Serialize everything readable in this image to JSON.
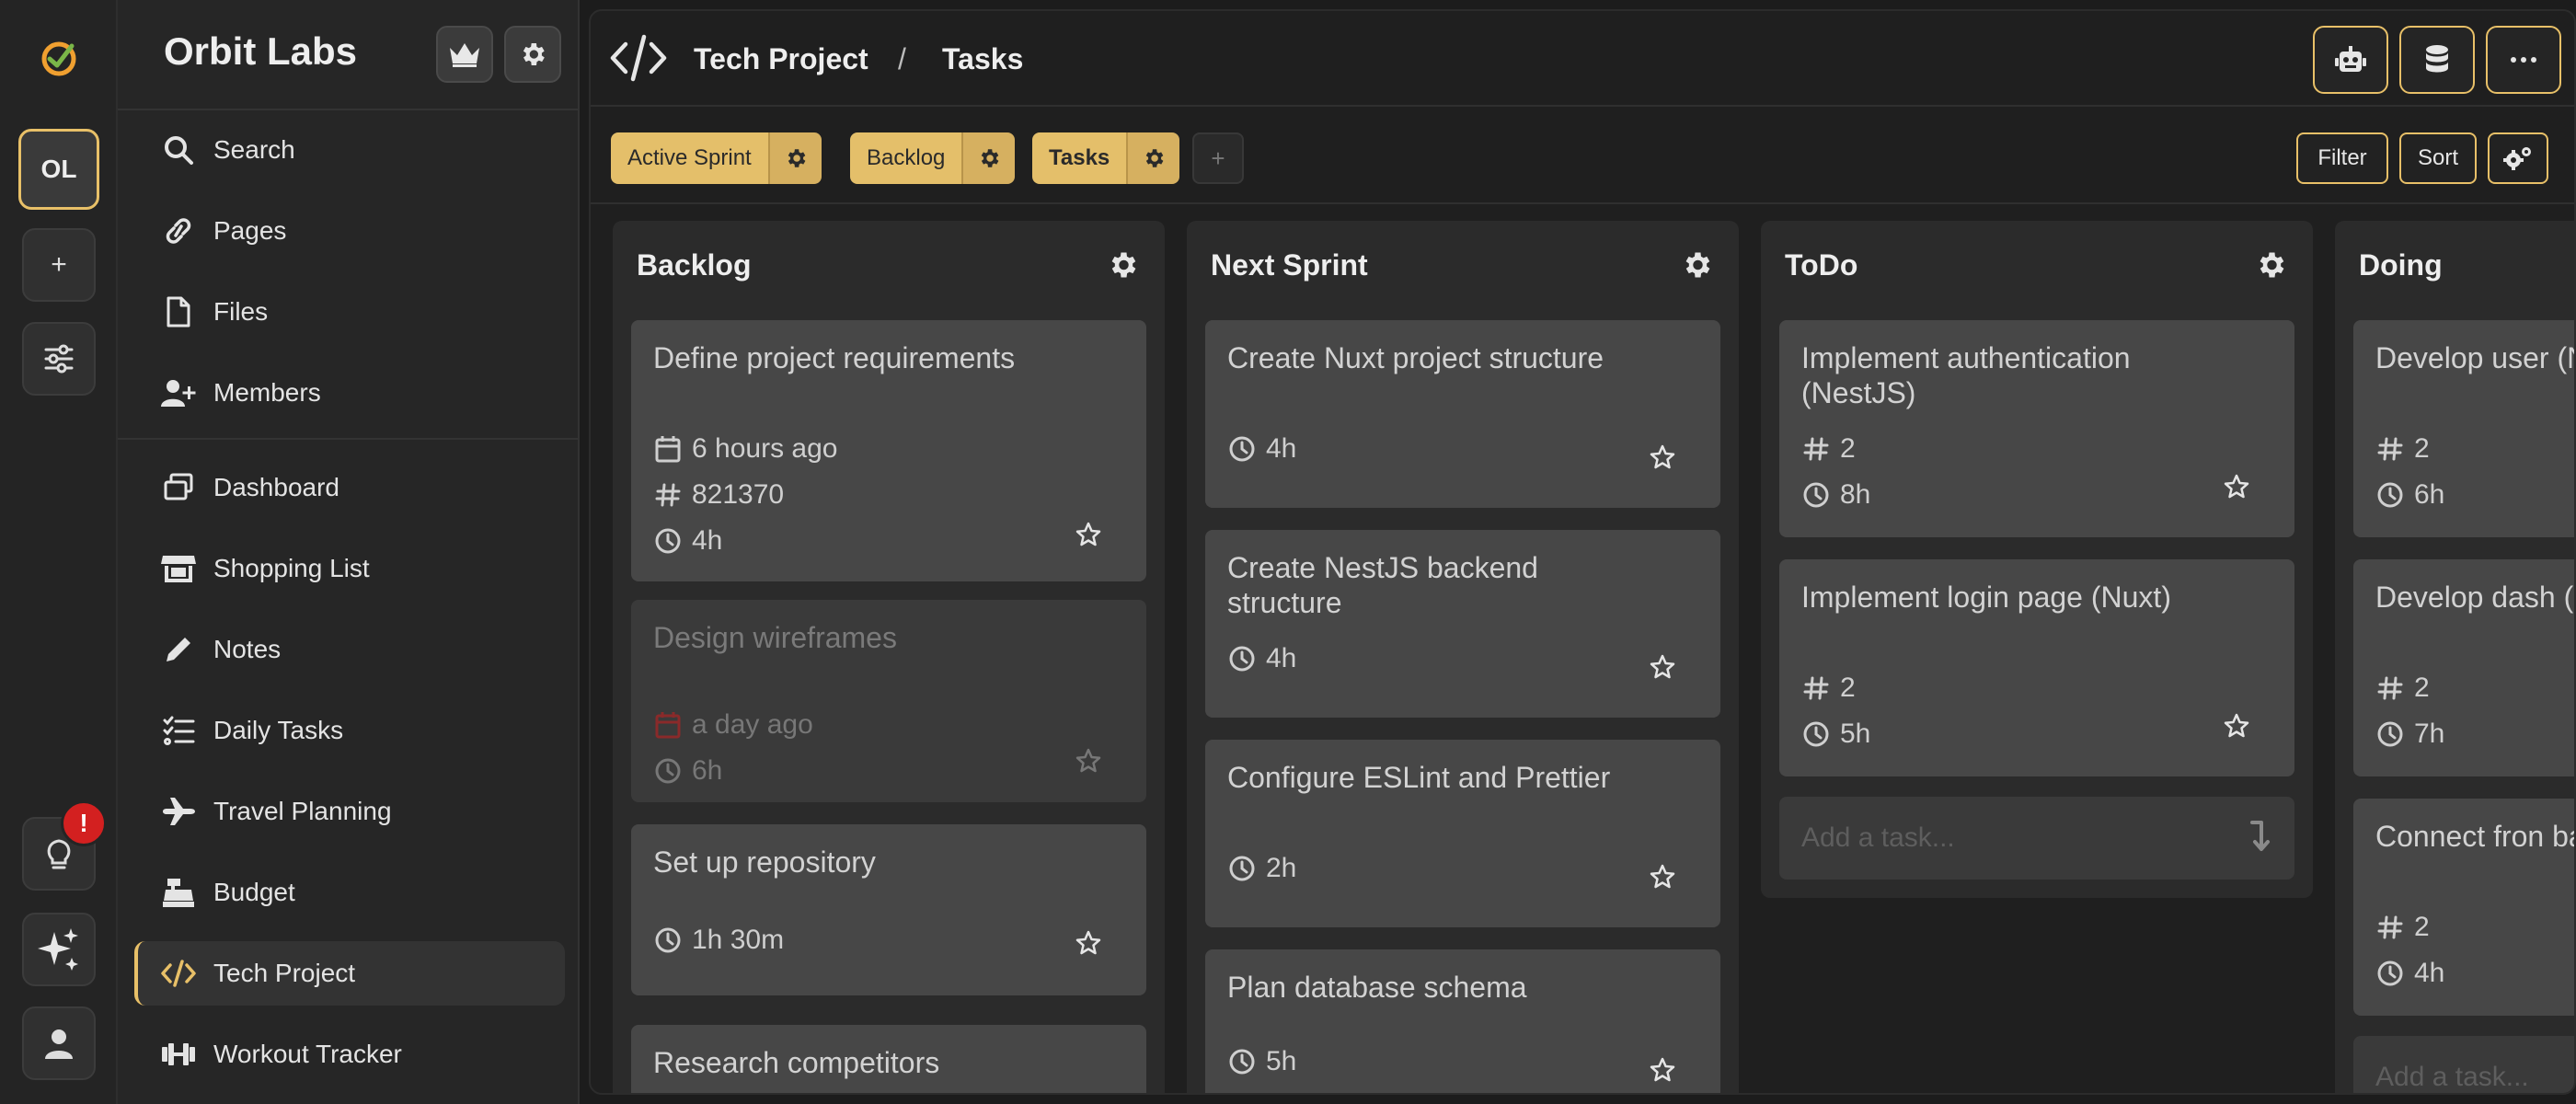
{
  "workspace": {
    "initials": "OL",
    "name": "Orbit Labs",
    "notification_badge": "!"
  },
  "rail": {
    "add_label": "+",
    "icons": [
      "app-logo-icon",
      "plus-icon",
      "sliders-icon",
      "lightbulb-icon",
      "sparkles-icon",
      "user-icon"
    ]
  },
  "sidebar": {
    "top_items": [
      {
        "label": "Search",
        "icon": "search-icon"
      },
      {
        "label": "Pages",
        "icon": "link-icon"
      },
      {
        "label": "Files",
        "icon": "file-icon"
      },
      {
        "label": "Members",
        "icon": "user-plus-icon"
      }
    ],
    "pages": [
      {
        "label": "Dashboard",
        "icon": "windows-icon"
      },
      {
        "label": "Shopping List",
        "icon": "store-icon"
      },
      {
        "label": "Notes",
        "icon": "pencil-icon"
      },
      {
        "label": "Daily Tasks",
        "icon": "checklist-icon"
      },
      {
        "label": "Travel Planning",
        "icon": "plane-icon"
      },
      {
        "label": "Budget",
        "icon": "cash-register-icon"
      },
      {
        "label": "Tech Project",
        "icon": "code-icon",
        "active": true
      },
      {
        "label": "Workout Tracker",
        "icon": "dumbbell-icon"
      }
    ]
  },
  "header": {
    "breadcrumb": {
      "project": "Tech Project",
      "separator": "/",
      "page": "Tasks"
    }
  },
  "views": {
    "tabs": [
      {
        "label": "Active Sprint"
      },
      {
        "label": "Backlog"
      },
      {
        "label": "Tasks",
        "selected": true
      }
    ],
    "add_label": "+",
    "filter_label": "Filter",
    "sort_label": "Sort"
  },
  "board": {
    "add_task_placeholder": "Add a task...",
    "columns": [
      {
        "title": "Backlog",
        "cards": [
          {
            "title": "Define project requirements",
            "date": "6 hours ago",
            "id": "821370",
            "estimate": "4h"
          },
          {
            "title": "Design wireframes",
            "date": "a day ago",
            "estimate": "6h",
            "dimmed": true
          },
          {
            "title": "Set up repository",
            "estimate": "1h 30m"
          },
          {
            "title": "Research competitors"
          }
        ]
      },
      {
        "title": "Next Sprint",
        "cards": [
          {
            "title": "Create Nuxt project structure",
            "estimate": "4h"
          },
          {
            "title": "Create NestJS backend structure",
            "estimate": "4h"
          },
          {
            "title": "Configure ESLint and Prettier",
            "estimate": "2h"
          },
          {
            "title": "Plan database schema",
            "estimate": "5h"
          }
        ]
      },
      {
        "title": "ToDo",
        "cards": [
          {
            "title": "Implement authentication (NestJS)",
            "points": "2",
            "estimate": "8h"
          },
          {
            "title": "Implement login page (Nuxt)",
            "points": "2",
            "estimate": "5h"
          }
        ]
      },
      {
        "title": "Doing",
        "cards": [
          {
            "title": "Develop user (NestJS)",
            "points": "2",
            "estimate": "6h"
          },
          {
            "title": "Develop dash (Nuxt)",
            "points": "2",
            "estimate": "7h"
          },
          {
            "title": "Connect fron backend (aut",
            "points": "2",
            "estimate": "4h"
          }
        ]
      }
    ]
  },
  "colors": {
    "accent": "#e8c068",
    "background": "#1c1c1c",
    "card": "#474747",
    "badge": "#d32020"
  }
}
